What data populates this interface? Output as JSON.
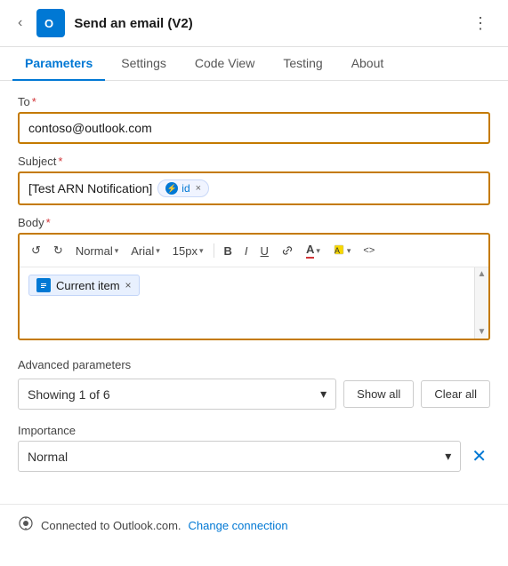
{
  "header": {
    "back_icon": "‹",
    "app_icon_label": "O",
    "title": "Send an email (V2)",
    "more_icon": "⋮"
  },
  "tabs": [
    {
      "label": "Parameters",
      "active": true
    },
    {
      "label": "Settings",
      "active": false
    },
    {
      "label": "Code View",
      "active": false
    },
    {
      "label": "Testing",
      "active": false
    },
    {
      "label": "About",
      "active": false
    }
  ],
  "form": {
    "to_label": "To",
    "to_required": "*",
    "to_value": "contoso@outlook.com",
    "subject_label": "Subject",
    "subject_required": "*",
    "subject_text": "[Test ARN Notification]",
    "subject_token_label": "id",
    "subject_token_close": "×",
    "body_label": "Body",
    "body_required": "*",
    "toolbar": {
      "undo": "↺",
      "redo": "↻",
      "style_label": "Normal",
      "font_label": "Arial",
      "size_label": "15px",
      "bold": "B",
      "italic": "I",
      "underline": "U",
      "link": "🔗",
      "font_color": "A",
      "highlight": "▓",
      "source": "<>"
    },
    "current_item_label": "Current item",
    "current_item_close": "×",
    "scroll_up": "▲",
    "scroll_down": "▼"
  },
  "advanced": {
    "section_label": "Advanced parameters",
    "dropdown_value": "Showing 1 of 6",
    "dropdown_chevron": "▾",
    "show_all_label": "Show all",
    "clear_all_label": "Clear all",
    "importance_label": "Importance",
    "importance_value": "Normal",
    "importance_chevron": "▾",
    "clear_btn_icon": "✕"
  },
  "footer": {
    "connection_icon": "🔗",
    "connection_text": "Connected to Outlook.com.",
    "change_link": "Change connection"
  }
}
